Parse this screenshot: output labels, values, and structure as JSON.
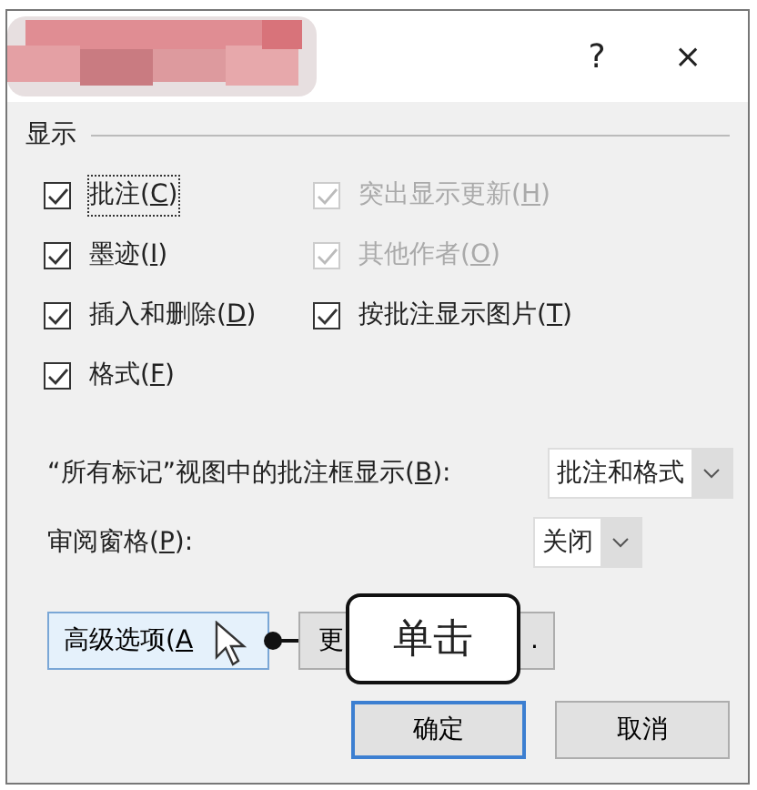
{
  "title_bar": {
    "help": "?",
    "close": "×"
  },
  "group": {
    "label": "显示"
  },
  "checkboxes": [
    {
      "before": "批注(",
      "key": "C",
      "after": ")",
      "checked": true,
      "disabled": false,
      "focused": true
    },
    {
      "before": "突出显示更新(",
      "key": "H",
      "after": ")",
      "checked": true,
      "disabled": true,
      "focused": false
    },
    {
      "before": "墨迹(",
      "key": "I",
      "after": ")",
      "checked": true,
      "disabled": false,
      "focused": false
    },
    {
      "before": "其他作者(",
      "key": "O",
      "after": ")",
      "checked": true,
      "disabled": true,
      "focused": false
    },
    {
      "before": "插入和删除(",
      "key": "D",
      "after": ")",
      "checked": true,
      "disabled": false,
      "focused": false
    },
    {
      "before": "按批注显示图片(",
      "key": "T",
      "after": ")",
      "checked": true,
      "disabled": false,
      "focused": false
    },
    {
      "before": "格式(",
      "key": "F",
      "after": ")",
      "checked": true,
      "disabled": false,
      "focused": false
    }
  ],
  "selects": [
    {
      "before": "“所有标记”视图中的批注框显示(",
      "key": "B",
      "after": "):",
      "value": "批注和格式"
    },
    {
      "before": "审阅窗格(",
      "key": "P",
      "after": "):",
      "value": "关闭"
    }
  ],
  "advanced_button": {
    "before": "高级选项(",
    "key": "A"
  },
  "second_button": {
    "visible_start": "更",
    "visible_end": "."
  },
  "callout": {
    "text": "单击"
  },
  "ok_button": {
    "label": "确定",
    "default": true
  },
  "cancel_button": {
    "label": "取消",
    "default": false
  }
}
